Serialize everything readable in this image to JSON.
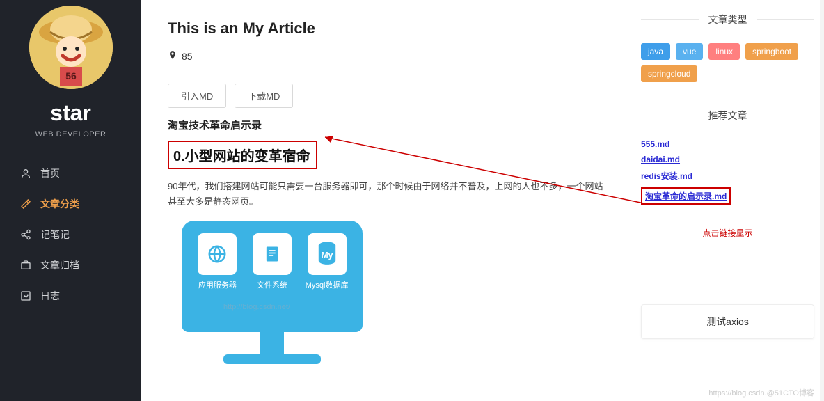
{
  "sidebar": {
    "name": "star",
    "role": "WEB DEVELOPER",
    "items": [
      {
        "icon": "user",
        "label": "首页"
      },
      {
        "icon": "edit",
        "label": "文章分类"
      },
      {
        "icon": "share",
        "label": "记笔记"
      },
      {
        "icon": "briefcase",
        "label": "文章归档"
      },
      {
        "icon": "chart",
        "label": "日志"
      }
    ]
  },
  "main": {
    "title": "This is an My Article",
    "views": "85",
    "buttons": {
      "import": "引入MD",
      "download": "下载MD"
    },
    "subhead": "淘宝技术革命启示录",
    "h2": "0.小型网站的变革宿命",
    "para": "90年代，我们搭建网站可能只需要一台服务器即可，那个时候由于网络并不普及，上网的人也不多，一个网站甚至大多是静态网页。",
    "cards": [
      {
        "label": "应用服务器",
        "icon": "globe"
      },
      {
        "label": "文件系统",
        "icon": "doc"
      },
      {
        "label": "Mysql数据库",
        "icon": "My"
      }
    ],
    "watermark": "https://blog.csdn.@51CTO博客"
  },
  "right": {
    "type_head": "文章类型",
    "tags": [
      {
        "label": "java",
        "cls": "c-java"
      },
      {
        "label": "vue",
        "cls": "c-vue"
      },
      {
        "label": "linux",
        "cls": "c-linux"
      },
      {
        "label": "springboot",
        "cls": "c-spring"
      },
      {
        "label": "springcloud",
        "cls": "c-cloud"
      }
    ],
    "rec_head": "推荐文章",
    "recs": [
      "555.md",
      "daidai.md",
      "redis安装.md",
      "淘宝革命的启示录.md"
    ],
    "note": "点击链接显示",
    "axios": "测试axios"
  }
}
